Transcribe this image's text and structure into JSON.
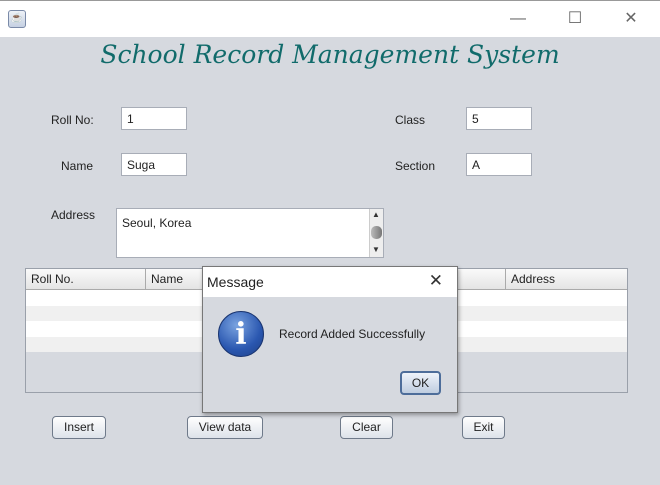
{
  "window": {
    "title": "School Record Management System",
    "controls": {
      "minimize": "—",
      "maximize": "☐",
      "close": "✕"
    }
  },
  "form": {
    "roll_label": "Roll No:",
    "roll_value": "1",
    "name_label": "Name",
    "name_value": "Suga",
    "class_label": "Class",
    "class_value": "5",
    "section_label": "Section",
    "section_value": "A",
    "address_label": "Address",
    "address_value": "Seoul, Korea"
  },
  "table": {
    "headers": [
      "Roll No.",
      "Name",
      "",
      "",
      "Address"
    ],
    "rows": 4
  },
  "buttons": {
    "insert": "Insert",
    "view": "View data",
    "clear": "Clear",
    "exit": "Exit"
  },
  "dialog": {
    "title": "Message",
    "message": "Record Added Successfully",
    "ok": "OK",
    "close": "✕",
    "icon": "information-icon"
  }
}
